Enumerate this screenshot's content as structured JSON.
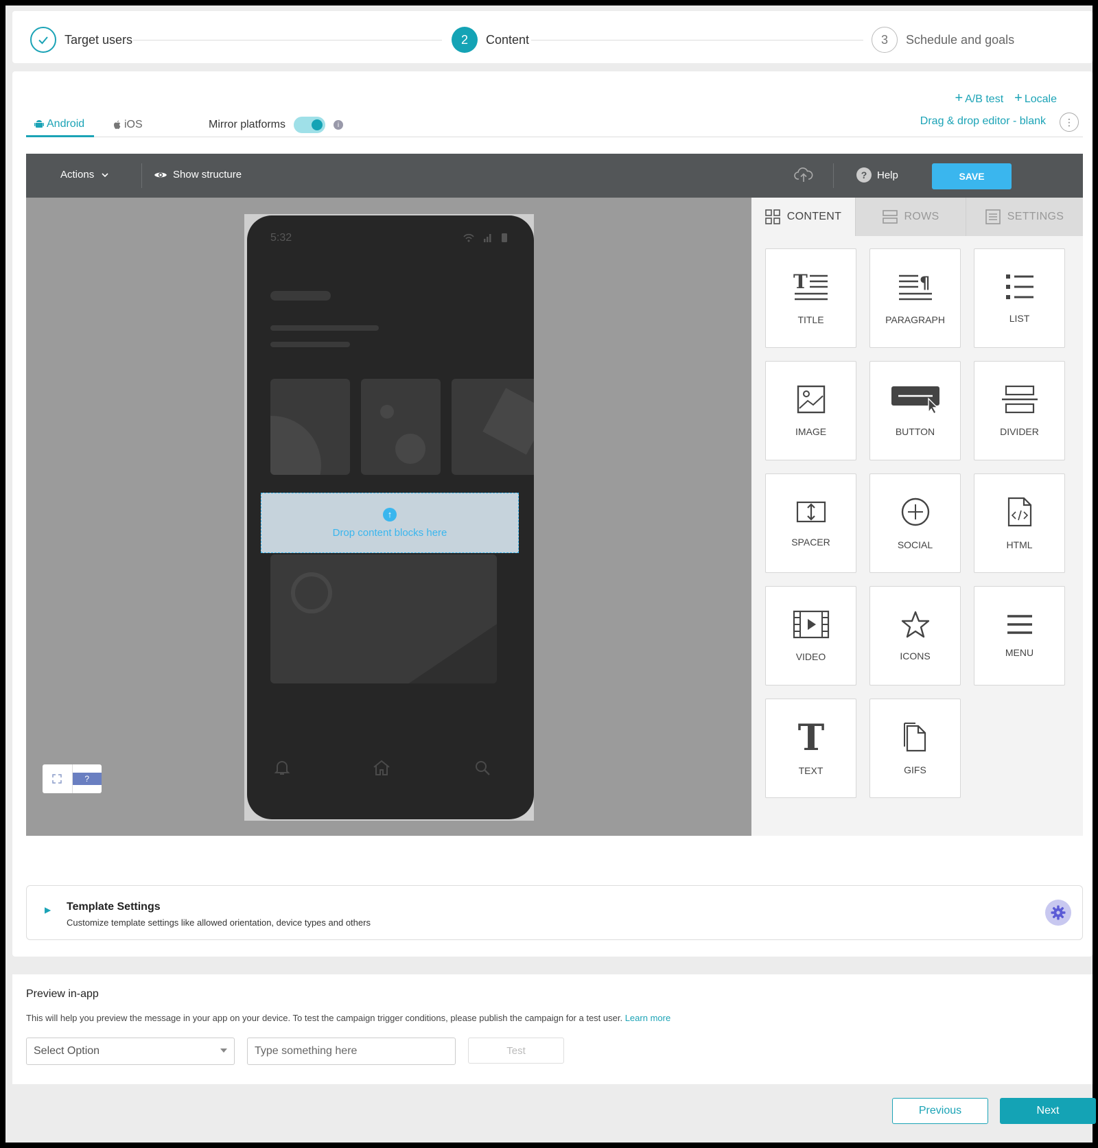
{
  "stepper": {
    "steps": [
      {
        "label": "Target users",
        "state": "done"
      },
      {
        "number": "2",
        "label": "Content",
        "state": "active"
      },
      {
        "number": "3",
        "label": "Schedule and goals",
        "state": "todo"
      }
    ]
  },
  "content": {
    "links": {
      "ab_test": "A/B test",
      "locale": "Locale"
    },
    "editor_name": "Drag & drop editor - blank",
    "platforms": {
      "android": "Android",
      "ios": "iOS",
      "active": "android"
    },
    "mirror": {
      "label": "Mirror platforms",
      "enabled": true
    }
  },
  "editor": {
    "toolbar": {
      "actions_label": "Actions",
      "show_structure_label": "Show structure",
      "help_label": "Help",
      "save_label": "SAVE"
    },
    "phone": {
      "time": "5:32"
    },
    "drop_zone_text": "Drop content blocks here",
    "side_tabs": [
      "CONTENT",
      "ROWS",
      "SETTINGS"
    ],
    "active_side_tab": "CONTENT",
    "blocks": [
      "TITLE",
      "PARAGRAPH",
      "LIST",
      "IMAGE",
      "BUTTON",
      "DIVIDER",
      "SPACER",
      "SOCIAL",
      "HTML",
      "VIDEO",
      "ICONS",
      "MENU",
      "TEXT",
      "GIFS"
    ]
  },
  "template_settings": {
    "title": "Template Settings",
    "subtitle": "Customize template settings like allowed orientation, device types and others"
  },
  "preview": {
    "title": "Preview in-app",
    "description": "This will help you preview the message in your app on your device. To test the campaign trigger conditions, please publish the campaign for a test user.",
    "learn_more": "Learn more",
    "select_placeholder": "Select Option",
    "input_placeholder": "Type something here",
    "test_label": "Test"
  },
  "footer": {
    "previous_label": "Previous",
    "next_label": "Next"
  },
  "colors": {
    "accent": "#14a3b5",
    "save": "#3ab6ee",
    "toolbar": "#535658"
  }
}
